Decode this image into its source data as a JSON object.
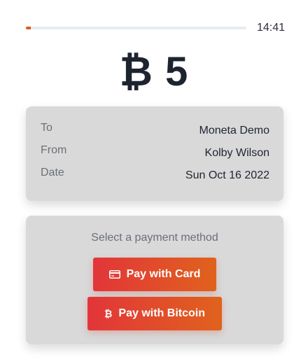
{
  "timer": {
    "remaining": "14:41",
    "progress_fraction": 0.022
  },
  "amount": {
    "display": "₿ 5"
  },
  "details": {
    "rows": [
      {
        "label": "To",
        "value": "Moneta Demo"
      },
      {
        "label": "From",
        "value": "Kolby Wilson"
      },
      {
        "label": "Date",
        "value": "Sun Oct 16 2022"
      }
    ]
  },
  "payment": {
    "title": "Select a payment method",
    "card_button_label": "Pay with Card",
    "bitcoin_button_label": "Pay with Bitcoin",
    "card_icon": "credit-card-icon",
    "bitcoin_icon": "bitcoin-icon"
  },
  "colors": {
    "accent": "#e05a26",
    "button_start": "#e2353a",
    "button_end": "#e0621d",
    "panel_bg": "#d9d9d9"
  }
}
